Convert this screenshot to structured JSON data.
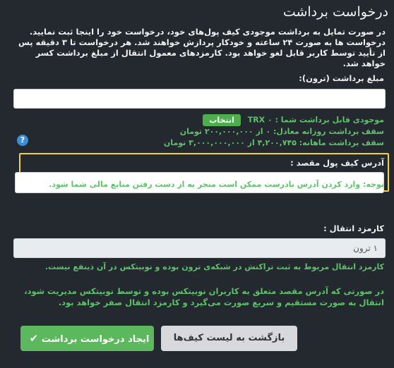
{
  "page_title": "درخواست برداشت",
  "intro_text": "در صورت تمایل به برداشت موجودی کیف پول‌های خود، درخواست خود را اینجا ثبت نمایید. درخواست ها به صورت ۲۴ ساعته و خودکار پردازش خواهند شد. هر درخواست تا ۳ دقیقه پس از تأیید توسط کاربر قابل لغو خواهد بود. کارمزدهای معمول انتقال از مبلغ برداشت کسر خواهد شد.",
  "amount": {
    "label": "مبلغ برداشت (ترون):",
    "value": "",
    "placeholder": ""
  },
  "balance": {
    "text": "موجودی قابل برداشت شما : ۰ TRX",
    "select_label": "انتخاب"
  },
  "limits": {
    "daily": "سقف برداشت روزانه معادل: ۰ از ۲۰۰,۰۰۰,۰۰۰ تومان",
    "monthly": "سقف برداشت ماهانه: ۴,۲۰۰,۷۴۵ از ۳,۰۰۰,۰۰۰,۰۰۰ تومان"
  },
  "help_icon_glyph": "?",
  "destination": {
    "label": "آدرس کیف پول مقصد :",
    "value": "",
    "placeholder": "",
    "warning": "توجه: وارد کردن آدرس نادرست ممکن است منجر به از دست رفتن منابع مالی شما شود."
  },
  "fee": {
    "label": "کارمزد انتقال :",
    "value": "۱ ترون",
    "note": "کارمزد انتقال مربوط به ثبت تراکنش در شبکه‌ی ترون بوده و نوبیتکس در آن ذینفع نیست."
  },
  "internal_note": "در صورتی که آدرس مقصد متعلق به کاربران نوبیتکس بوده و توسط نوبیتکس مدیریت شود، انتقال به صورت مستقیم و سریع صورت می‌گیرد و کارمزد انتقال صفر خواهد بود.",
  "buttons": {
    "create_label": "ایجاد درخواست برداشت",
    "back_label": "بازگشت به لیست کیف‌ها"
  },
  "colors": {
    "background": "#24292f",
    "accent_green": "#5cb85c",
    "highlight_yellow": "#f2d43a"
  }
}
